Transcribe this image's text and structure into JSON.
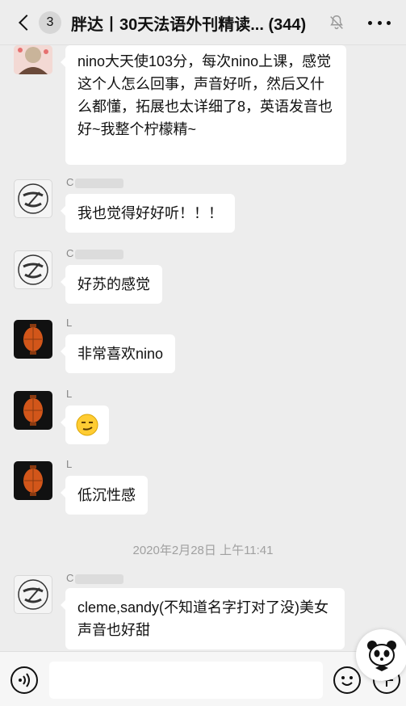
{
  "header": {
    "unread_count": "3",
    "title": "胖达丨30天法语外刊精读... (344)"
  },
  "messages": [
    {
      "sender": "",
      "text": "nino大天使103分，每次nino上课，感觉这个人怎么回事，声音好听，然后又什么都懂，拓展也太详细了8，英语发音也好~我整个柠檬精~"
    },
    {
      "sender": "C",
      "text": "我也觉得好好听！！！"
    },
    {
      "sender": "C",
      "text": "好苏的感觉"
    },
    {
      "sender": "L",
      "text": "非常喜欢nino"
    },
    {
      "sender": "L",
      "text": ""
    },
    {
      "sender": "L",
      "text": "低沉性感"
    },
    {
      "sender": "C",
      "text": "cleme,sandy(不知道名字打对了没)美女声音也好甜"
    }
  ],
  "timestamp": "2020年2月28日 上午11:41",
  "input": {
    "placeholder": ""
  },
  "icons": {
    "back": "chevron-left-icon",
    "mute": "bell-off-icon",
    "more": "more-dots-icon",
    "voice": "voice-icon",
    "emoji": "emoji-icon",
    "plus": "plus-icon"
  },
  "colors": {
    "background": "#ededed",
    "bubble": "#ffffff"
  }
}
